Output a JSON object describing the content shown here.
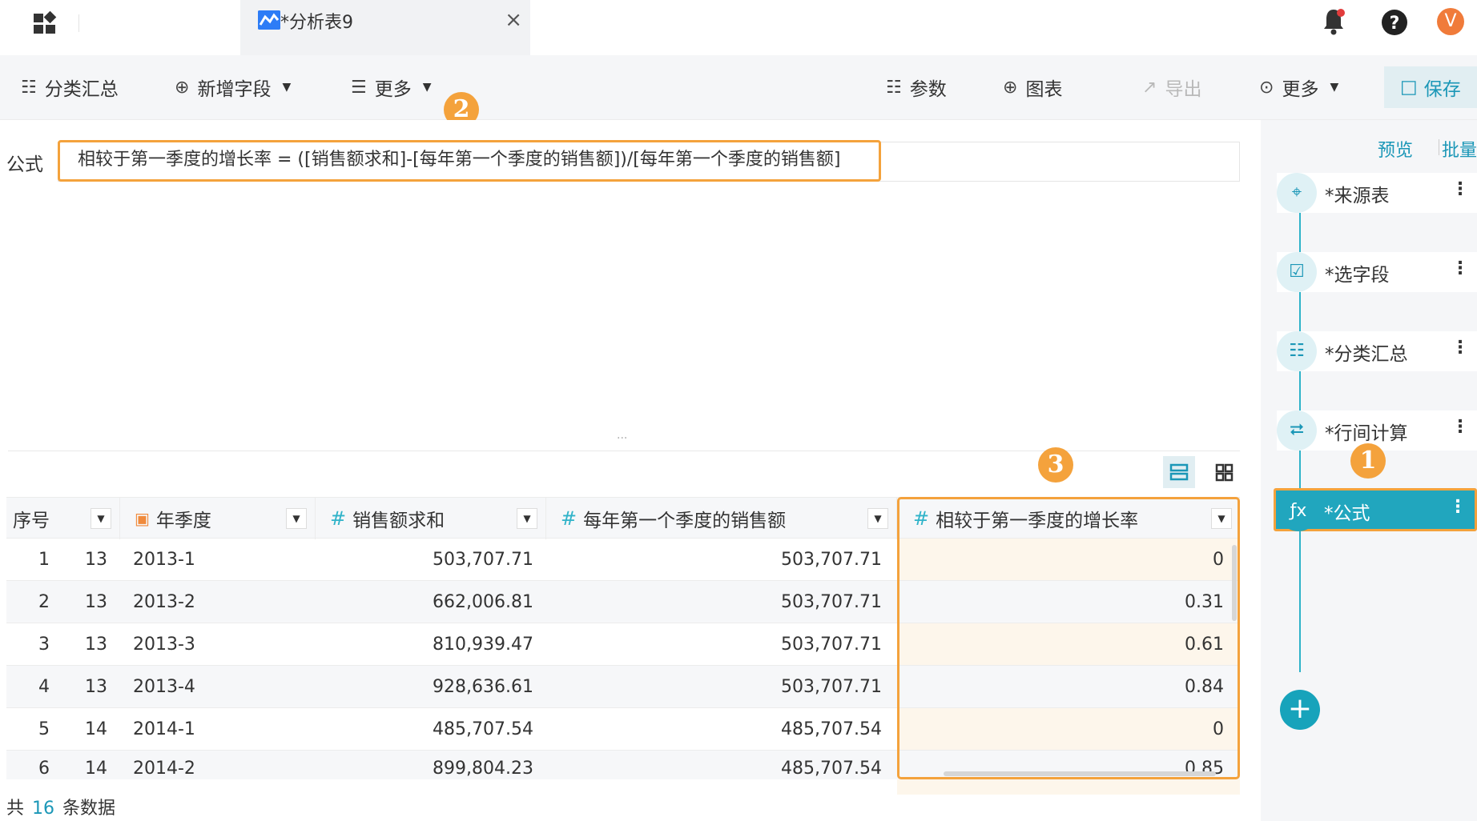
{
  "tab": {
    "title": "*分析表9",
    "close": "×"
  },
  "avatar": "V",
  "toolbar": {
    "group_summary": "分类汇总",
    "add_field": "新增字段",
    "more_left": "更多",
    "params": "参数",
    "chart": "图表",
    "export": "导出",
    "more_right": "更多",
    "save": "保存"
  },
  "badges": {
    "b1": "1",
    "b2": "2",
    "b3": "3"
  },
  "formula": {
    "label": "公式",
    "expression": "相较于第一季度的增长率 = ([销售额求和]-[每年第一个季度的销售额])/[每年第一个季度的销售额]"
  },
  "table": {
    "headers": [
      "序号",
      "年季度",
      "销售额求和",
      "每年第一个季度的销售额",
      "相较于第一季度的增长率"
    ],
    "rows": [
      {
        "idx": "1",
        "group": "13",
        "quarter": "2013-1",
        "sales": "503,707.71",
        "first": "503,707.71",
        "growth": "0"
      },
      {
        "idx": "2",
        "group": "13",
        "quarter": "2013-2",
        "sales": "662,006.81",
        "first": "503,707.71",
        "growth": "0.31"
      },
      {
        "idx": "3",
        "group": "13",
        "quarter": "2013-3",
        "sales": "810,939.47",
        "first": "503,707.71",
        "growth": "0.61"
      },
      {
        "idx": "4",
        "group": "13",
        "quarter": "2013-4",
        "sales": "928,636.61",
        "first": "503,707.71",
        "growth": "0.84"
      },
      {
        "idx": "5",
        "group": "14",
        "quarter": "2014-1",
        "sales": "485,707.54",
        "first": "485,707.54",
        "growth": "0"
      },
      {
        "idx": "6",
        "group": "14",
        "quarter": "2014-2",
        "sales": "899,804.23",
        "first": "485,707.54",
        "growth": "0.85"
      }
    ]
  },
  "footer": {
    "prefix": "共",
    "count": "16",
    "suffix": "条数据"
  },
  "right_panel": {
    "preview": "预览",
    "batch": "批量",
    "steps": [
      "*来源表",
      "*选字段",
      "*分类汇总",
      "*行间计算",
      "*公式"
    ],
    "add": "+"
  },
  "colors": {
    "accent": "#21a6be",
    "highlight": "#f4a23c"
  }
}
